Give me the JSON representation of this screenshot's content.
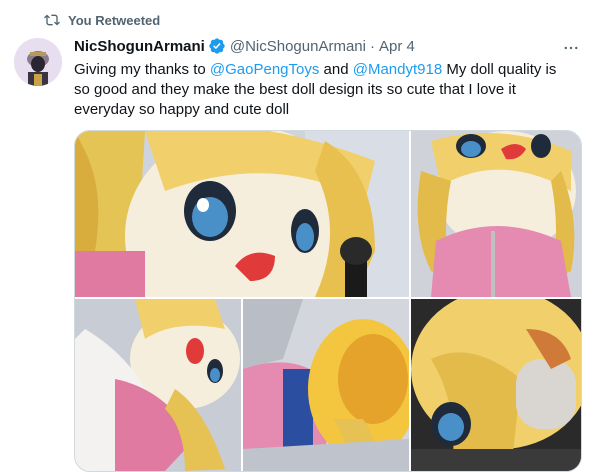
{
  "retweet": {
    "label": "You Retweeted",
    "icon": "retweet-icon"
  },
  "tweet": {
    "display_name": "NicShogunArmani",
    "handle": "@NicShogunArmani",
    "separator": "·",
    "date": "Apr 4",
    "verified_icon": "verified-badge-icon",
    "more_icon": "more-options-icon",
    "text": {
      "t1": "Giving my thanks to ",
      "m1": "@GaoPengToys",
      "t2": " and ",
      "m2": "@Mandyt918",
      "t3": " My doll quality is so good and they make the best doll design its so cute that I love it everyday so happy and cute doll"
    }
  },
  "colors": {
    "accent": "#1d9bf0",
    "secondary_text": "#536471",
    "primary_text": "#0f1419",
    "border": "#cfd9de"
  }
}
